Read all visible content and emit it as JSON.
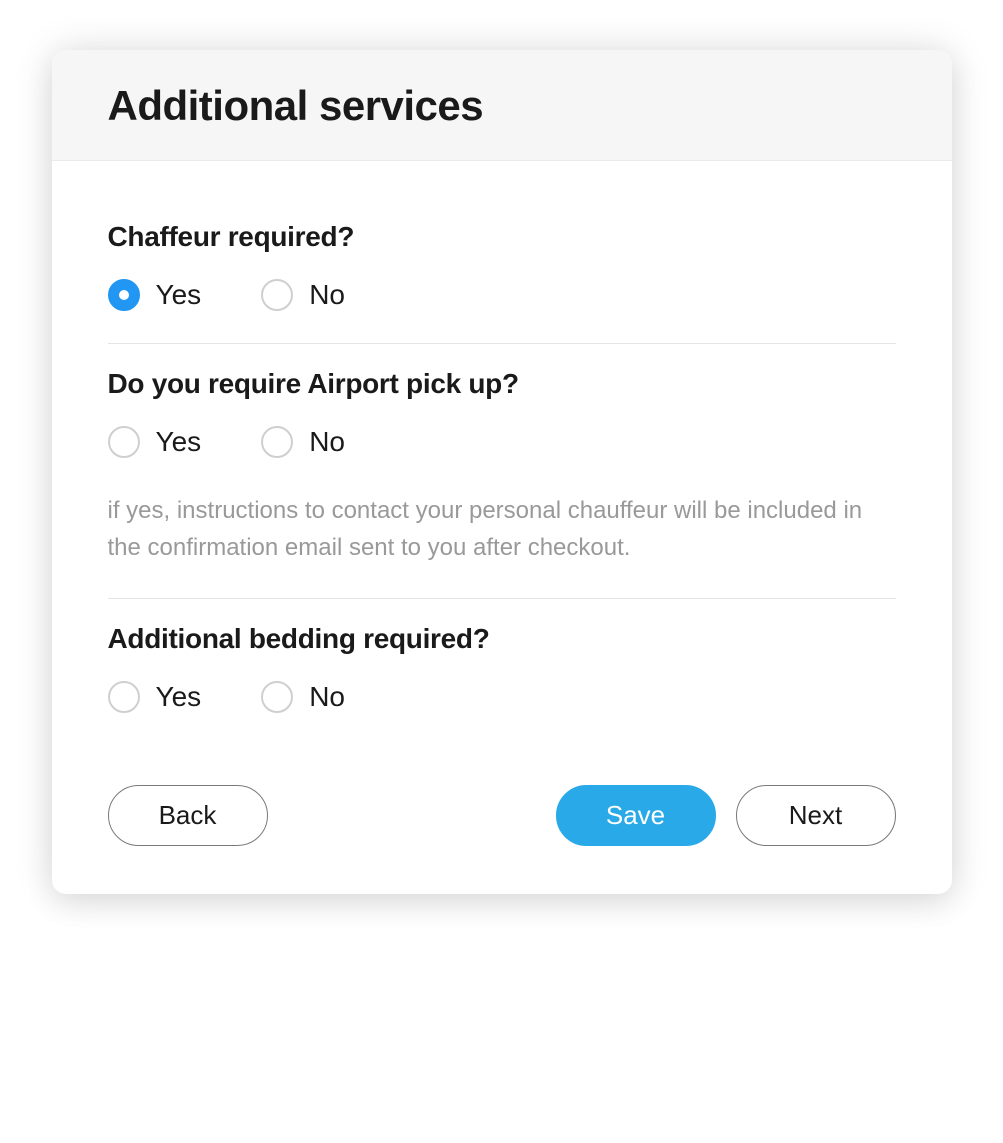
{
  "header": {
    "title": "Additional services"
  },
  "questions": {
    "chaffeur": {
      "title": "Chaffeur required?",
      "options": {
        "yes": "Yes",
        "no": "No"
      },
      "selected": "yes"
    },
    "airport": {
      "title": "Do you require Airport pick up?",
      "options": {
        "yes": "Yes",
        "no": "No"
      },
      "selected": null,
      "help": "if yes, instructions to contact your personal chauffeur will be included in the confirmation email sent to you after checkout."
    },
    "bedding": {
      "title": "Additional bedding required?",
      "options": {
        "yes": "Yes",
        "no": "No"
      },
      "selected": null
    }
  },
  "buttons": {
    "back": "Back",
    "save": "Save",
    "next": "Next"
  }
}
